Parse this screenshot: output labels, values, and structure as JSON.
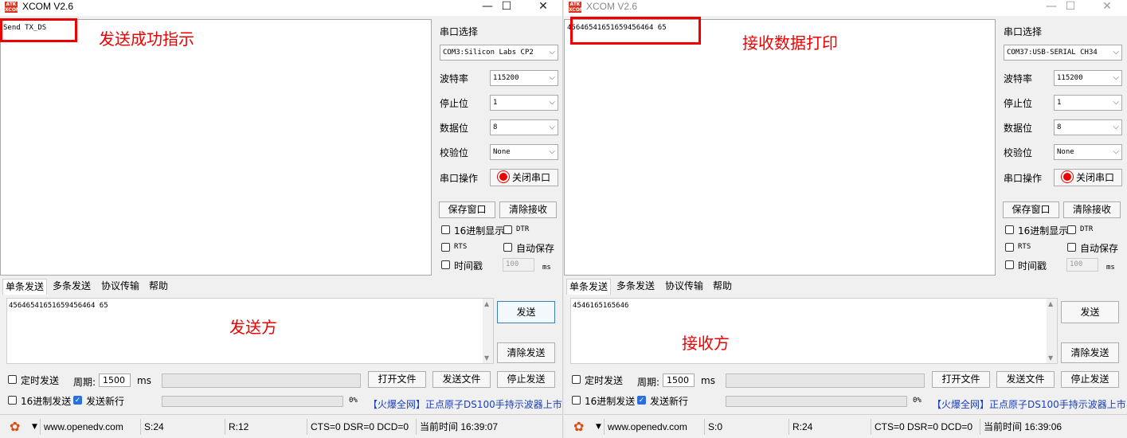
{
  "left": {
    "title": "XCOM V2.6",
    "receive_text": "Send TX_DS",
    "annotation_top": "发送成功指示",
    "annotation_bottom": "发送方",
    "port": {
      "label": "串口选择",
      "value": "COM3:Silicon Labs CP2"
    },
    "baud": {
      "label": "波特率",
      "value": "115200"
    },
    "stop": {
      "label": "停止位",
      "value": "1"
    },
    "databits": {
      "label": "数据位",
      "value": "8"
    },
    "parity": {
      "label": "校验位",
      "value": "None"
    },
    "op": {
      "label": "串口操作",
      "button": "关闭串口"
    },
    "save_window": "保存窗口",
    "clear_receive": "清除接收",
    "hex_display": "16进制显示",
    "dtr": "DTR",
    "rts": "RTS",
    "auto_save": "自动保存",
    "timestamp": "时间戳",
    "interval": "100",
    "ms": "ms",
    "tabs": [
      "单条发送",
      "多条发送",
      "协议传输",
      "帮助"
    ],
    "send_text": "45646541651659456464 65",
    "send_btn": "发送",
    "clear_send": "清除发送",
    "timed_send": "定时发送",
    "period_label": "周期:",
    "period_value": "1500",
    "period_unit": "ms",
    "open_file": "打开文件",
    "send_file": "发送文件",
    "stop_send": "停止发送",
    "hex_send": "16进制发送",
    "send_newline": "发送新行",
    "percent": "0%",
    "ad": "【火爆全网】正点原子DS100手持示波器上市",
    "status": {
      "url": "www.openedv.com",
      "s": "S:24",
      "r": "R:12",
      "lines": "CTS=0 DSR=0 DCD=0",
      "time": "当前时间 16:39:07"
    }
  },
  "right": {
    "title": "XCOM V2.6",
    "receive_text": "45646541651659456464 65",
    "annotation_top": "接收数据打印",
    "annotation_bottom": "接收方",
    "port": {
      "label": "串口选择",
      "value": "COM37:USB-SERIAL CH34"
    },
    "baud": {
      "label": "波特率",
      "value": "115200"
    },
    "stop": {
      "label": "停止位",
      "value": "1"
    },
    "databits": {
      "label": "数据位",
      "value": "8"
    },
    "parity": {
      "label": "校验位",
      "value": "None"
    },
    "op": {
      "label": "串口操作",
      "button": "关闭串口"
    },
    "save_window": "保存窗口",
    "clear_receive": "清除接收",
    "hex_display": "16进制显示",
    "dtr": "DTR",
    "rts": "RTS",
    "auto_save": "自动保存",
    "timestamp": "时间戳",
    "interval": "100",
    "ms": "ms",
    "tabs": [
      "单条发送",
      "多条发送",
      "协议传输",
      "帮助"
    ],
    "send_text": "4546165165646",
    "send_btn": "发送",
    "clear_send": "清除发送",
    "timed_send": "定时发送",
    "period_label": "周期:",
    "period_value": "1500",
    "period_unit": "ms",
    "open_file": "打开文件",
    "send_file": "发送文件",
    "stop_send": "停止发送",
    "hex_send": "16进制发送",
    "send_newline": "发送新行",
    "percent": "0%",
    "ad": "【火爆全网】正点原子DS100手持示波器上市",
    "status": {
      "url": "www.openedv.com",
      "s": "S:0",
      "r": "R:24",
      "lines": "CTS=0 DSR=0 DCD=0",
      "time": "当前时间 16:39:06"
    }
  },
  "icons": {
    "app": "xcom-logo-icon",
    "settings": "gear-icon"
  },
  "colors": {
    "annotation": "#e00000",
    "ad_link": "#1a3fbf",
    "focus_border": "#3c7fb1"
  }
}
